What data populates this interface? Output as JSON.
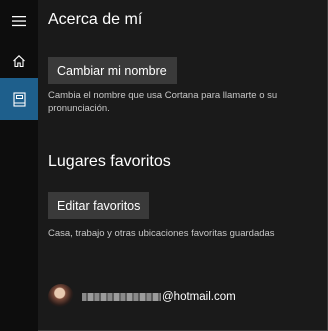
{
  "rail": {
    "items": [
      {
        "icon": "hamburger-menu-icon"
      },
      {
        "icon": "home-icon"
      },
      {
        "icon": "notebook-icon",
        "active": true
      }
    ],
    "active_color": "#1e5f8c"
  },
  "about": {
    "title": "Acerca de mí",
    "change_name_label": "Cambiar mi nombre",
    "change_name_description": "Cambia el nombre que usa Cortana para llamarte o su pronunciación."
  },
  "places": {
    "title": "Lugares favoritos",
    "edit_label": "Editar favoritos",
    "edit_description": "Casa, trabajo y otras ubicaciones favoritas guardadas"
  },
  "account": {
    "email_domain": "@hotmail.com"
  },
  "colors": {
    "background": "#1a1a1a",
    "rail": "#0d0d0d",
    "button": "#3a3a3a"
  }
}
